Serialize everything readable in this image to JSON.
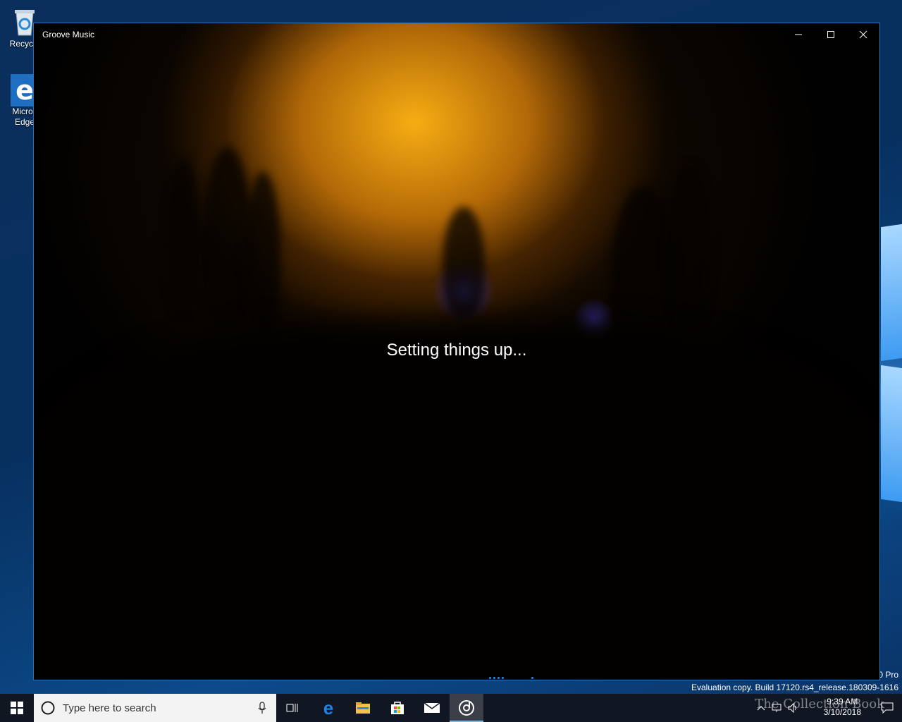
{
  "desktop": {
    "icons": [
      {
        "label_line1": "Recycle",
        "label_line2": "",
        "icon": "recycle-bin-icon"
      },
      {
        "label_line1": "Micros",
        "label_line2": "Edge",
        "icon": "edge-icon"
      }
    ],
    "edition_text": "0 Pro",
    "build_text": "Evaluation copy. Build 17120.rs4_release.180309-1616"
  },
  "window": {
    "title": "Groove Music",
    "status_text": "Setting things up...",
    "controls": {
      "minimize": "minimize-icon",
      "maximize": "maximize-icon",
      "close": "close-icon"
    }
  },
  "taskbar": {
    "search_placeholder": "Type here to search",
    "apps": [
      "task-view-icon",
      "edge-icon",
      "file-explorer-icon",
      "store-icon",
      "mail-icon",
      "groove-music-icon"
    ],
    "clock_time": "9:39 AM",
    "clock_date": "3/10/2018",
    "overlay_watermark": "The Collection Book"
  },
  "colors": {
    "accent": "#2b8ae6",
    "window_border": "#2f6fb4",
    "taskbar": "#101622"
  }
}
